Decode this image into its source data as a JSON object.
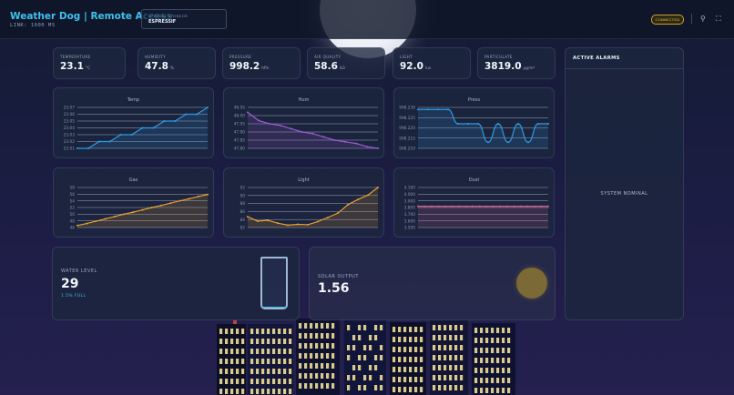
{
  "header": {
    "title": "Weather Dog | Remote Access",
    "link": "LINK: 1000 MS",
    "sponsor_label": "OFFICIAL SPONSOR",
    "sponsor_name": "ESPRESSIF",
    "status": "CONNECTED",
    "icons": [
      "pin-icon",
      "fullscreen-icon"
    ],
    "status_color": "#c9a02a",
    "accent_color": "#3fc0ee"
  },
  "metrics": [
    {
      "label": "TEMPERATURE",
      "value": "23.1",
      "unit": "°C"
    },
    {
      "label": "HUMIDITY",
      "value": "47.8",
      "unit": "%"
    },
    {
      "label": "PRESSURE",
      "value": "998.2",
      "unit": "hPa"
    },
    {
      "label": "AIR QUALITY",
      "value": "58.6",
      "unit": "kΩ"
    },
    {
      "label": "LIGHT",
      "value": "92.0",
      "unit": "lux"
    },
    {
      "label": "PARTICULATE",
      "value": "3819.0",
      "unit": "µg/m³"
    }
  ],
  "charts": [
    {
      "title": "Temp",
      "color": "#2f9be6",
      "yticks": [
        "23.07",
        "23.06",
        "23.05",
        "23.04",
        "23.03",
        "23.02",
        "23.01"
      ],
      "values": [
        23.01,
        23.01,
        23.02,
        23.02,
        23.03,
        23.03,
        23.04,
        23.04,
        23.05,
        23.05,
        23.06,
        23.06,
        23.07
      ]
    },
    {
      "title": "Hum",
      "color": "#a05ad6",
      "yticks": [
        "48.05",
        "48.00",
        "47.95",
        "47.90",
        "47.85",
        "47.80"
      ],
      "values": [
        48.02,
        47.97,
        47.95,
        47.94,
        47.92,
        47.9,
        47.89,
        47.87,
        47.85,
        47.84,
        47.83,
        47.81,
        47.8
      ]
    },
    {
      "title": "Press",
      "color": "#2f9be6",
      "yticks": [
        "998.230",
        "998.225",
        "998.220",
        "998.215",
        "998.210"
      ],
      "values": [
        998.229,
        998.229,
        998.229,
        998.229,
        998.222,
        998.222,
        998.222,
        998.213,
        998.222,
        998.213,
        998.222,
        998.213,
        998.222,
        998.222
      ]
    },
    {
      "title": "Gas",
      "color": "#e8a030",
      "yticks": [
        "58",
        "56",
        "54",
        "52",
        "50",
        "48",
        "46"
      ],
      "values": [
        46.6,
        47.2,
        47.9,
        48.6,
        49.3,
        50.0,
        50.6,
        51.3,
        52.0,
        52.6,
        53.3,
        54.0,
        54.6,
        55.3,
        55.9
      ]
    },
    {
      "title": "Light",
      "color": "#e8a030",
      "yticks": [
        "92",
        "90",
        "88",
        "86",
        "84",
        "82"
      ],
      "values": [
        84.7,
        83.6,
        83.8,
        83.1,
        82.6,
        82.8,
        82.7,
        83.5,
        84.5,
        85.6,
        87.7,
        89.0,
        90.1,
        92.0
      ]
    },
    {
      "title": "Dust",
      "color": "#d0608a",
      "yticks": [
        "4.100",
        "4.000",
        "3.900",
        "3.800",
        "3.700",
        "3.600",
        "3.500"
      ],
      "values": [
        3.819,
        3.819,
        3.819,
        3.819,
        3.819,
        3.819,
        3.819,
        3.819,
        3.819,
        3.819,
        3.819,
        3.819,
        3.819,
        3.819,
        3.819,
        3.819,
        3.819,
        3.819,
        3.819,
        3.819
      ]
    }
  ],
  "alarms": {
    "title": "ACTIVE ALARMS",
    "status": "SYSTEM NOMINAL"
  },
  "water": {
    "label": "WATER LEVEL",
    "value": "29",
    "fill_text": "1.5% FULL",
    "fill_fraction": 0.015
  },
  "solar": {
    "label": "SOLAR OUTPUT",
    "value": "1.56"
  }
}
